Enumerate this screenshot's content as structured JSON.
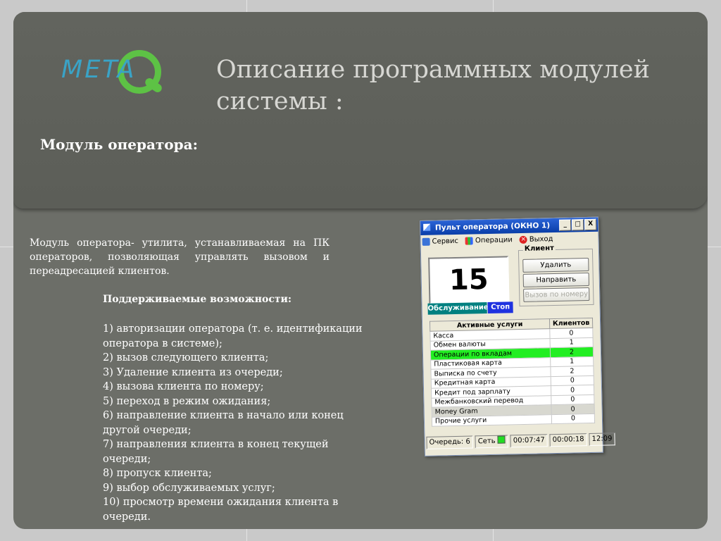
{
  "logo": {
    "text": "METAQ"
  },
  "slide": {
    "title": "Описание программных модулей системы :",
    "subtitle": "Модуль оператора:",
    "description": "Модуль оператора- утилита, устанавливаемая на ПК операторов, позволяющая управлять вызовом и переадресацией клиентов.",
    "features_heading": "Поддерживаемые возможности:",
    "features": [
      "1) авторизации оператора (т. е. идентификации оператора в системе);",
      "2) вызов следующего клиента;",
      "3) Удаление клиента из очереди;",
      "4) вызова клиента по номеру;",
      "5) переход в режим ожидания;",
      "6) направление клиента в начало или конец другой очереди;",
      "7) направления клиента в конец текущей очереди;",
      "8) пропуск клиента;",
      "9) выбор обслуживаемых услуг;",
      "10) просмотр времени ожидания клиента в очереди."
    ]
  },
  "window": {
    "title": "Пульт оператора (ОКНО 1)",
    "title_buttons": [
      "_",
      "□",
      "X"
    ],
    "menu": [
      {
        "label": "Сервис",
        "icon": "service-icon"
      },
      {
        "label": "Операции",
        "icon": "operations-icon"
      },
      {
        "label": "Выход",
        "icon": "exit-icon"
      }
    ],
    "counter": "15",
    "client_group": "Клиент",
    "buttons": {
      "delete": "Удалить",
      "redirect": "Направить",
      "call_by_number": "Вызов по номеру"
    },
    "status": {
      "serving": "Обслуживание",
      "stop": "Стоп"
    },
    "table": {
      "headers": [
        "Активные услуги",
        "Клиентов"
      ],
      "rows": [
        {
          "service": "Касса",
          "count": "0"
        },
        {
          "service": "Обмен валюты",
          "count": "1"
        },
        {
          "service": "Операции по вкладам",
          "count": "2"
        },
        {
          "service": "Пластиковая карта",
          "count": "1"
        },
        {
          "service": "Выписка по счету",
          "count": "2"
        },
        {
          "service": "Кредитная карта",
          "count": "0"
        },
        {
          "service": "Кредит под зарплату",
          "count": "0"
        },
        {
          "service": "Межбанковский перевод",
          "count": "0"
        },
        {
          "service": "Money Gram",
          "count": "0"
        },
        {
          "service": "Прочие услуги",
          "count": "0"
        }
      ]
    },
    "statusbar": {
      "queue_label": "Очередь:",
      "queue_value": "6",
      "network_label": "Сеть",
      "time1": "00:07:47",
      "time2": "00:00:18",
      "clock": "12:09"
    },
    "colors": {
      "highlight": "#22ee22",
      "serving": "#008080",
      "stop": "#1f32e0",
      "titlebar": "#0a3ea8"
    }
  }
}
